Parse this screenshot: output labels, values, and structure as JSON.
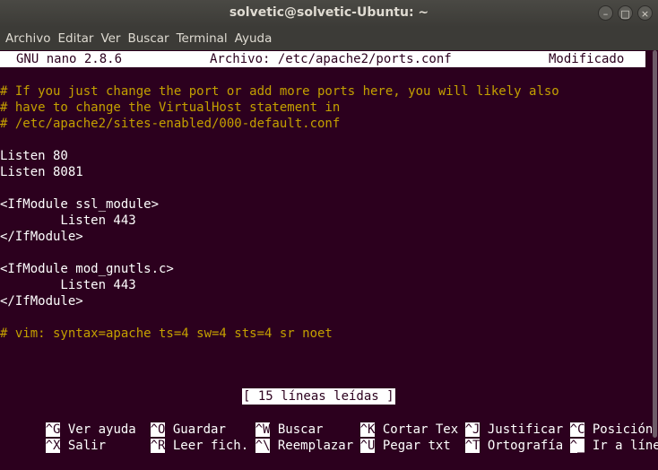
{
  "window": {
    "title": "solvetic@solvetic-Ubuntu: ~",
    "controls": {
      "minimize": "–",
      "maximize": "□",
      "close": "×"
    }
  },
  "menu": [
    "Archivo",
    "Editar",
    "Ver",
    "Buscar",
    "Terminal",
    "Ayuda"
  ],
  "nano": {
    "version": "GNU nano 2.8.6",
    "file": "Archivo: /etc/apache2/ports.conf",
    "modified": "Modificado"
  },
  "file_lines": [
    "# If you just change the port or add more ports here, you will likely also",
    "# have to change the VirtualHost statement in",
    "# /etc/apache2/sites-enabled/000-default.conf",
    "",
    "Listen 80",
    "Listen 8081",
    "",
    "<IfModule ssl_module>",
    "        Listen 443",
    "</IfModule>",
    "",
    "<IfModule mod_gnutls.c>",
    "        Listen 443",
    "</IfModule>",
    "",
    "# vim: syntax=apache ts=4 sw=4 sts=4 sr noet"
  ],
  "status_message": "[ 15 líneas leídas ]",
  "shortcuts": [
    [
      {
        "key": "^G",
        "label": " Ver ayuda"
      },
      {
        "key": "^O",
        "label": " Guardar"
      },
      {
        "key": "^W",
        "label": " Buscar"
      },
      {
        "key": "^K",
        "label": " Cortar Tex"
      },
      {
        "key": "^J",
        "label": " Justificar"
      },
      {
        "key": "^C",
        "label": " Posición"
      }
    ],
    [
      {
        "key": "^X",
        "label": " Salir"
      },
      {
        "key": "^R",
        "label": " Leer fich."
      },
      {
        "key": "^\\",
        "label": " Reemplazar"
      },
      {
        "key": "^U",
        "label": " Pegar txt"
      },
      {
        "key": "^T",
        "label": " Ortografía"
      },
      {
        "key": "^_",
        "label": " Ir a línea"
      }
    ]
  ],
  "colors": {
    "terminal_bg": "#2c001e",
    "comment": "#c4a000",
    "text": "#ffffff"
  }
}
